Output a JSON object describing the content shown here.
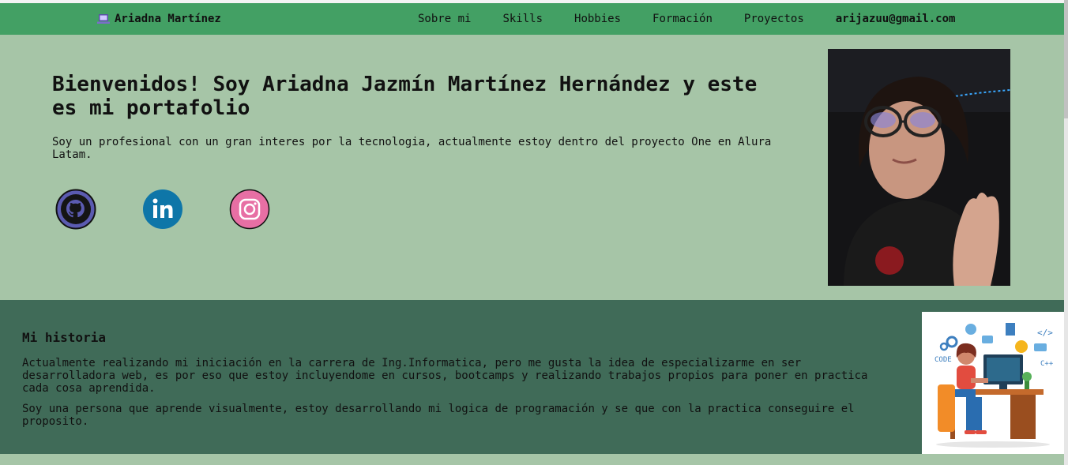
{
  "header": {
    "brand": "Ariadna Martínez",
    "nav": [
      "Sobre mi",
      "Skills",
      "Hobbies",
      "Formación",
      "Proyectos"
    ],
    "email": "arijazuu@gmail.com"
  },
  "hero": {
    "title": "Bienvenidos! Soy Ariadna Jazmín Martínez Hernández y este es mi portafolio",
    "intro": "Soy un profesional con un gran interes por la tecnologia, actualmente estoy dentro del proyecto One en Alura Latam.",
    "social": [
      "github-icon",
      "linkedin-icon",
      "instagram-icon"
    ]
  },
  "historia": {
    "heading": "Mi historia",
    "p1": "Actualmente realizando mi iniciación en la carrera de Ing.Informatica, pero me gusta la idea de especializarme en ser desarrolladora web, es por eso que estoy incluyendome en cursos, bootcamps y realizando trabajos propios para poner en practica cada cosa aprendida.",
    "p2": "Soy una persona que aprende visualmente, estoy desarrollando mi logica de programación y se que con la practica conseguire el proposito.",
    "illustration_labels": [
      "CODE",
      "C++",
      "</>"
    ]
  },
  "colors": {
    "header": "#43a064",
    "hero_bg": "#a6c5a7",
    "historia_bg": "#406b58",
    "github": "#5b5bb0",
    "linkedin": "#0e76a8",
    "instagram": "#e76fa4"
  }
}
